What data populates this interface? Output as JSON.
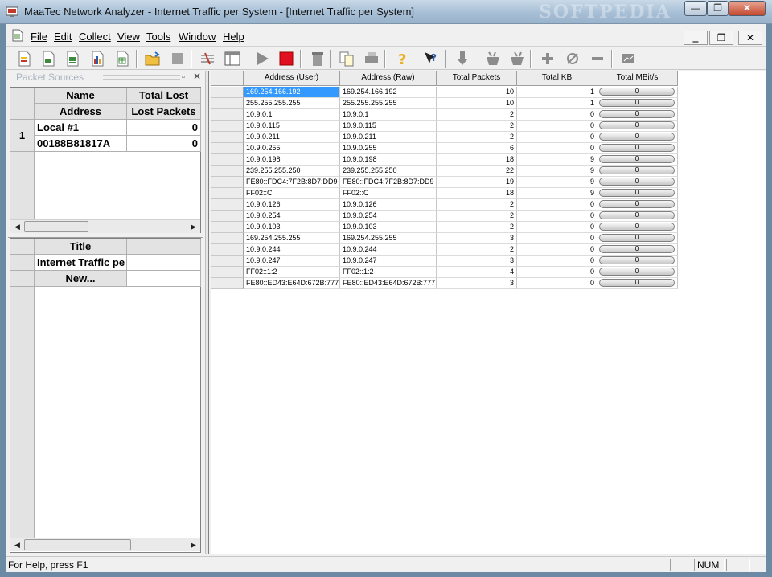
{
  "window": {
    "title": "MaaTec Network Analyzer - Internet Traffic per System - [Internet Traffic per System]",
    "watermark": "SOFTPEDIA",
    "min_glyph": "—",
    "max_glyph": "❐",
    "close_glyph": "✕"
  },
  "menu": {
    "items": [
      "File",
      "Edit",
      "Collect",
      "View",
      "Tools",
      "Window",
      "Help"
    ],
    "mdi_min": "‗",
    "mdi_restore": "❐",
    "mdi_close": "✕"
  },
  "toolbar": {
    "icons": [
      "new-doc-icon",
      "save-icon",
      "export-icon",
      "bar-chart-icon",
      "table-icon",
      "open-folder-icon",
      "stop-square-icon",
      "network-icon",
      "window-icon",
      "play-icon",
      "record-stop-icon",
      "trash-icon",
      "copy-icon",
      "print-icon",
      "help-icon",
      "context-help-icon",
      "download-icon",
      "filter-add-icon",
      "filter-remove-icon",
      "plus-icon",
      "empty-set-icon",
      "minus-icon",
      "display-icon"
    ]
  },
  "packet_sources": {
    "title": "Packet Sources",
    "pin": "▫",
    "close": "✕",
    "headers": [
      [
        "Name",
        "Total Lost"
      ],
      [
        "Address",
        "Lost Packets"
      ]
    ],
    "rows": [
      {
        "index": "1",
        "name": "Local #1",
        "total_lost": "0",
        "address": "00188B81817A",
        "lost_packets": "0"
      }
    ]
  },
  "views": {
    "header": "Title",
    "items": [
      "Internet Traffic pe",
      "New..."
    ]
  },
  "table": {
    "columns": [
      "Address (User)",
      "Address (Raw)",
      "Total Packets",
      "Total KB",
      "Total MBit/s"
    ],
    "rows": [
      [
        "169.254.166.192",
        "169.254.166.192",
        "10",
        "1",
        "0"
      ],
      [
        "255.255.255.255",
        "255.255.255.255",
        "10",
        "1",
        "0"
      ],
      [
        "10.9.0.1",
        "10.9.0.1",
        "2",
        "0",
        "0"
      ],
      [
        "10.9.0.115",
        "10.9.0.115",
        "2",
        "0",
        "0"
      ],
      [
        "10.9.0.211",
        "10.9.0.211",
        "2",
        "0",
        "0"
      ],
      [
        "10.9.0.255",
        "10.9.0.255",
        "6",
        "0",
        "0"
      ],
      [
        "10.9.0.198",
        "10.9.0.198",
        "18",
        "9",
        "0"
      ],
      [
        "239.255.255.250",
        "239.255.255.250",
        "22",
        "9",
        "0"
      ],
      [
        "FE80::FDC4:7F2B:8D7:DD9",
        "FE80::FDC4:7F2B:8D7:DD9",
        "19",
        "9",
        "0"
      ],
      [
        "FF02::C",
        "FF02::C",
        "18",
        "9",
        "0"
      ],
      [
        "10.9.0.126",
        "10.9.0.126",
        "2",
        "0",
        "0"
      ],
      [
        "10.9.0.254",
        "10.9.0.254",
        "2",
        "0",
        "0"
      ],
      [
        "10.9.0.103",
        "10.9.0.103",
        "2",
        "0",
        "0"
      ],
      [
        "169.254.255.255",
        "169.254.255.255",
        "3",
        "0",
        "0"
      ],
      [
        "10.9.0.244",
        "10.9.0.244",
        "2",
        "0",
        "0"
      ],
      [
        "10.9.0.247",
        "10.9.0.247",
        "3",
        "0",
        "0"
      ],
      [
        "FF02::1:2",
        "FF02::1:2",
        "4",
        "0",
        "0"
      ],
      [
        "FE80::ED43:E64D:672B:777",
        "FE80::ED43:E64D:672B:777",
        "3",
        "0",
        "0"
      ]
    ]
  },
  "status": {
    "text": "For Help, press F1",
    "num": "NUM"
  },
  "scroll": {
    "left": "◀",
    "right": "▶"
  },
  "colors": {
    "selection": "#3399ff",
    "title_gradient": "#a7bfd6"
  }
}
